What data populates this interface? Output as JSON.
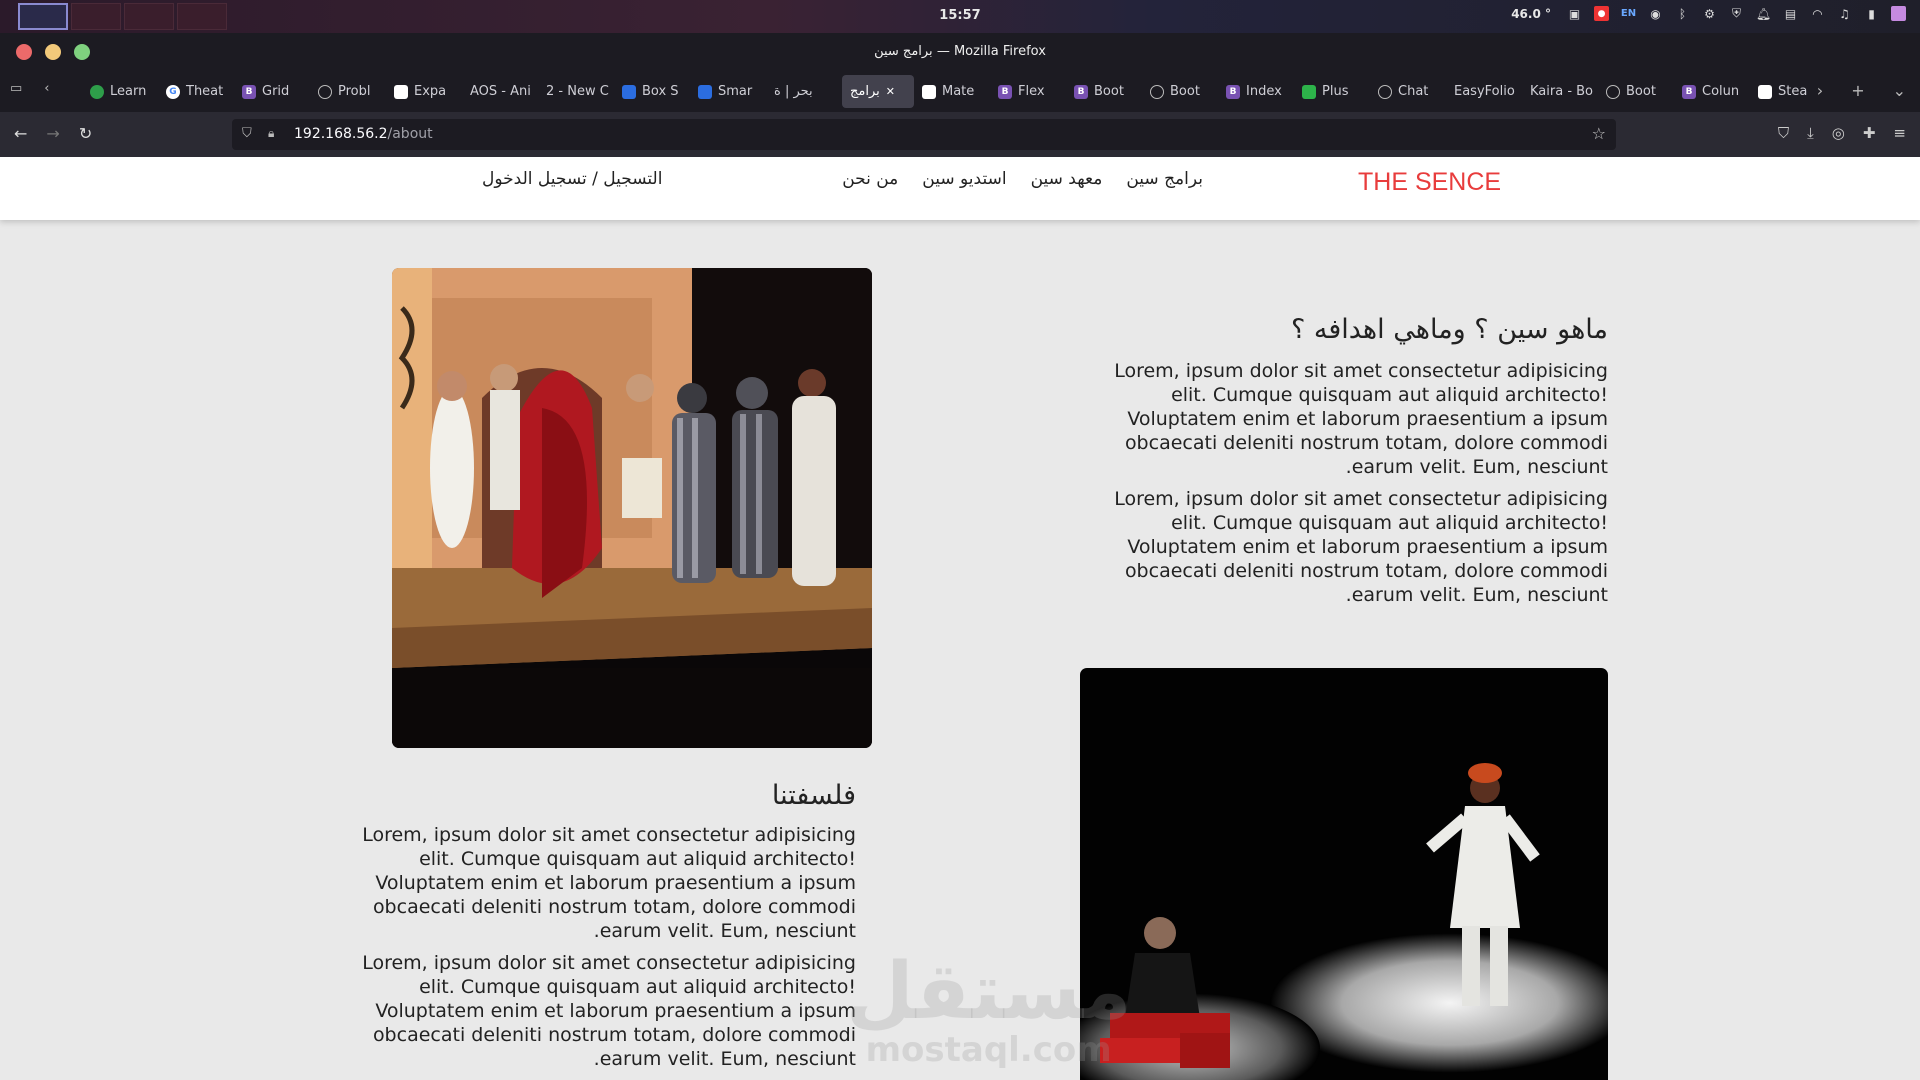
{
  "os": {
    "clock": "15:57",
    "temperature": "46.0 °",
    "lang": "EN",
    "icons": [
      "screenshot-icon",
      "record-icon",
      "lang-icon",
      "discord-icon",
      "bluetooth-icon",
      "network-icon",
      "vpn-icon",
      "bell-icon",
      "flag-us-icon",
      "wifi-icon",
      "music-icon",
      "battery-icon",
      "folder-icon"
    ]
  },
  "window": {
    "title": "برامج سين — Mozilla Firefox"
  },
  "tabs": [
    {
      "label": "Learn",
      "icon": "g"
    },
    {
      "label": "Theat",
      "icon": "gg"
    },
    {
      "label": "Grid",
      "icon": "b"
    },
    {
      "label": "Probl",
      "icon": "o"
    },
    {
      "label": "Expa",
      "icon": "w"
    },
    {
      "label": "AOS - Ani",
      "icon": ""
    },
    {
      "label": "2 - New C",
      "icon": ""
    },
    {
      "label": "Box S",
      "icon": "bl"
    },
    {
      "label": "Smar",
      "icon": "bl"
    },
    {
      "label": "بحر | ة",
      "icon": ""
    },
    {
      "label": "برامج",
      "icon": "",
      "active": true
    },
    {
      "label": "Mate",
      "icon": "w"
    },
    {
      "label": "Flex",
      "icon": "b"
    },
    {
      "label": "Boot",
      "icon": "b"
    },
    {
      "label": "Boot",
      "icon": "o"
    },
    {
      "label": "Index",
      "icon": "b"
    },
    {
      "label": "Plus",
      "icon": "grn"
    },
    {
      "label": "Chat",
      "icon": "o"
    },
    {
      "label": "EasyFolio",
      "icon": ""
    },
    {
      "label": "Kaira - Bo",
      "icon": ""
    },
    {
      "label": "Boot",
      "icon": "o"
    },
    {
      "label": "Colun",
      "icon": "b"
    },
    {
      "label": "Stea",
      "icon": "w"
    }
  ],
  "address": {
    "host": "192.168.56.2",
    "path": "/about"
  },
  "site": {
    "brand": "THE SENCE",
    "nav": [
      "برامج سين",
      "معهد سين",
      "استديو سين",
      "من نحن"
    ],
    "auth": "التسجيل / تسجيل الدخول"
  },
  "section1": {
    "heading": "ماهو سين ؟ وماهي اهدافه ؟",
    "p1": "Lorem, ipsum dolor sit amet consectetur adipisicing elit. Cumque quisquam aut aliquid architecto! Voluptatem enim et laborum praesentium a ipsum obcaecati deleniti nostrum totam, dolore commodi earum velit. Eum, nesciunt.",
    "p2": "Lorem, ipsum dolor sit amet consectetur adipisicing elit. Cumque quisquam aut aliquid architecto! Voluptatem enim et laborum praesentium a ipsum obcaecati deleniti nostrum totam, dolore commodi earum velit. Eum, nesciunt."
  },
  "section2": {
    "heading": "فلسفتنا",
    "p1": "Lorem, ipsum dolor sit amet consectetur adipisicing elit. Cumque quisquam aut aliquid architecto! Voluptatem enim et laborum praesentium a ipsum obcaecati deleniti nostrum totam, dolore commodi earum velit. Eum, nesciunt.",
    "p2": "Lorem, ipsum dolor sit amet consectetur adipisicing elit. Cumque quisquam aut aliquid architecto! Voluptatem enim et laborum praesentium a ipsum obcaecati deleniti nostrum totam, dolore commodi earum velit. Eum, nesciunt."
  },
  "watermark": {
    "arabic": "مستقل",
    "latin": "mostaql.com"
  },
  "colors": {
    "brand": "#e83c3c",
    "page_bg": "#e9e9e9",
    "browser_chrome": "#1c1b22"
  }
}
